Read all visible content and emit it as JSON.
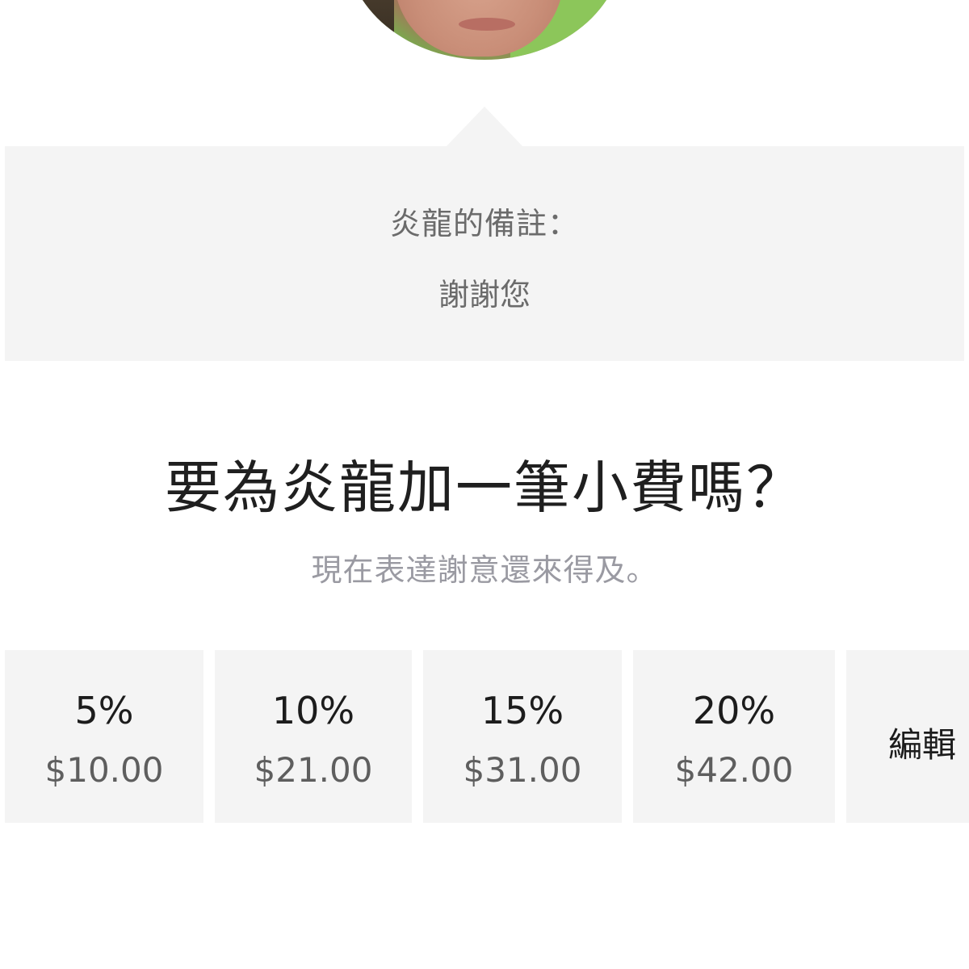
{
  "note": {
    "title": "炎龍的備註：",
    "message": "謝謝您"
  },
  "tip_prompt": {
    "heading": "要為炎龍加一筆小費嗎？",
    "subheading": "現在表達謝意還來得及。"
  },
  "tip_options": [
    {
      "percent": "5%",
      "amount": "$10.00"
    },
    {
      "percent": "10%",
      "amount": "$21.00"
    },
    {
      "percent": "15%",
      "amount": "$31.00"
    },
    {
      "percent": "20%",
      "amount": "$42.00"
    }
  ],
  "tip_edit": {
    "label": "編輯"
  },
  "colors": {
    "panel_background": "#f4f4f4",
    "heading_text": "#1f1f1f",
    "secondary_text": "#9a9aa2",
    "amount_text": "#5e5e5e"
  }
}
